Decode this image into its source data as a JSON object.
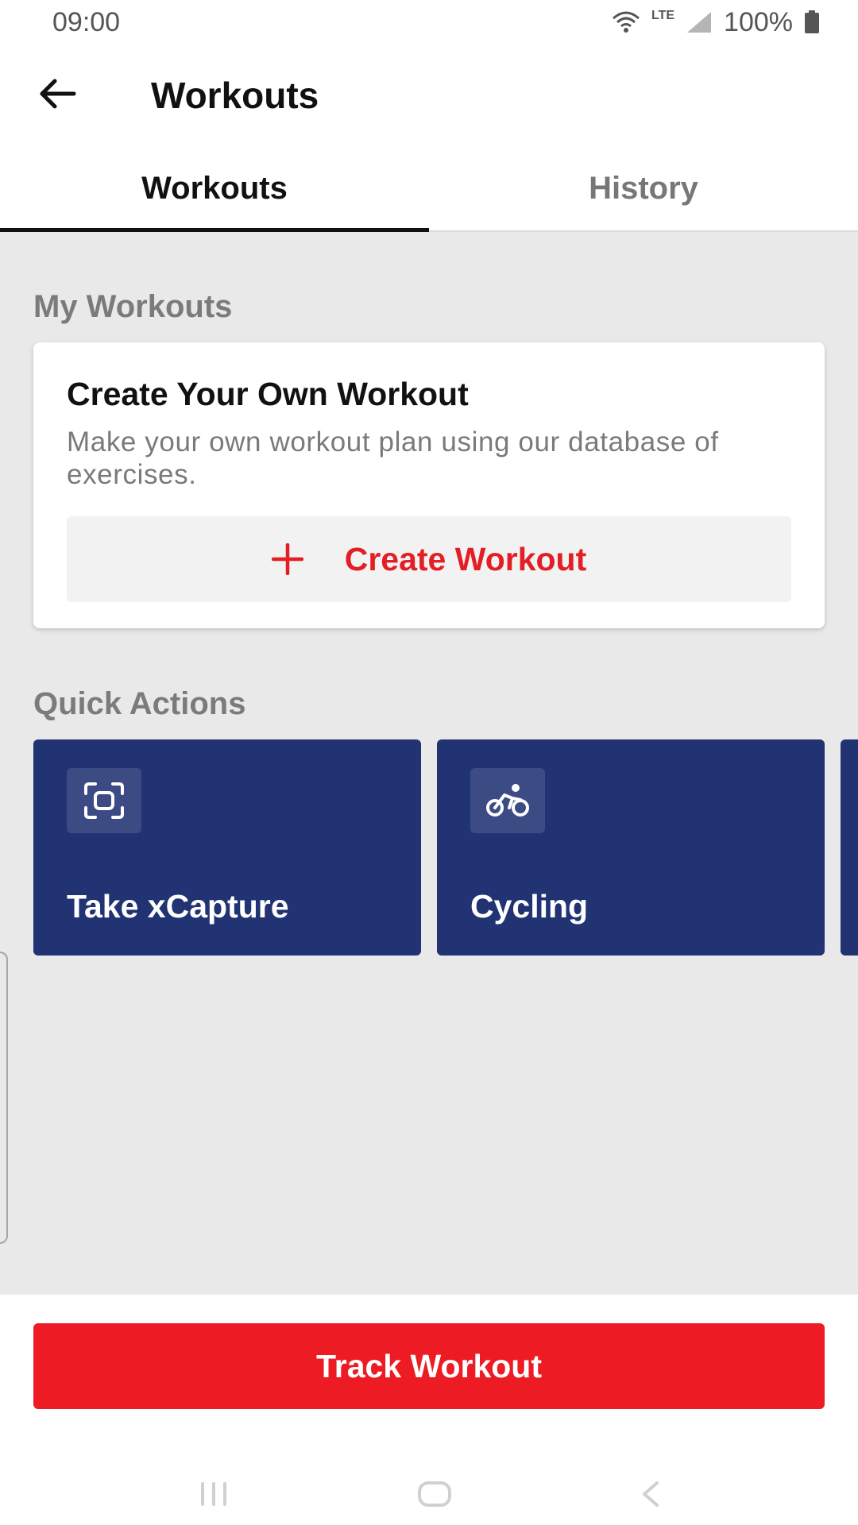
{
  "status_bar": {
    "time": "09:00",
    "network": "LTE",
    "battery": "100%",
    "icons": [
      "wifi-icon",
      "signal-icon",
      "battery-icon"
    ]
  },
  "app_bar": {
    "title": "Workouts",
    "back_icon": "arrow-left-icon"
  },
  "tabs": [
    {
      "label": "Workouts",
      "active": true
    },
    {
      "label": "History",
      "active": false
    }
  ],
  "my_workouts": {
    "heading": "My Workouts",
    "card": {
      "title": "Create Your Own Workout",
      "description": "Make your own workout plan using our database of exercises.",
      "button_label": "Create Workout",
      "button_icon": "plus-icon"
    }
  },
  "quick_actions": {
    "heading": "Quick Actions",
    "items": [
      {
        "label": "Take xCapture",
        "icon": "scan-frame-icon"
      },
      {
        "label": "Cycling",
        "icon": "cyclist-icon"
      }
    ]
  },
  "bottom": {
    "track_button": "Track Workout"
  },
  "nav_bar": {
    "icons": [
      "recent-apps-icon",
      "home-icon",
      "back-nav-icon"
    ]
  },
  "colors": {
    "accent_red": "#ED1C24",
    "card_navy": "#213373",
    "background": "#E9E9E9"
  }
}
